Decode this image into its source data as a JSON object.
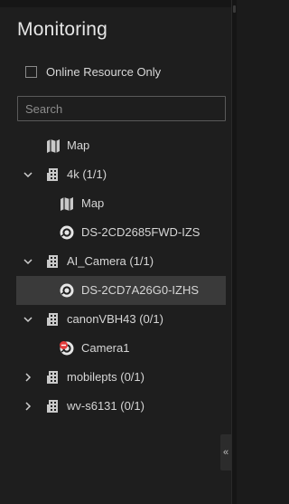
{
  "panel": {
    "title": "Monitoring"
  },
  "filter": {
    "online_only_label": "Online Resource Only",
    "checked": false
  },
  "search": {
    "placeholder": "Search",
    "value": ""
  },
  "tree": [
    {
      "label": "Map",
      "icon": "map-icon",
      "level": 1,
      "expandable": false
    },
    {
      "label": "4k (1/1)",
      "icon": "building-icon",
      "level": 0,
      "expandable": true,
      "expanded": true
    },
    {
      "label": "Map",
      "icon": "map-icon",
      "level": 2,
      "expandable": false
    },
    {
      "label": "DS-2CD2685FWD-IZS",
      "icon": "camera-icon",
      "level": 2,
      "expandable": false
    },
    {
      "label": "AI_Camera (1/1)",
      "icon": "building-icon",
      "level": 0,
      "expandable": true,
      "expanded": true
    },
    {
      "label": "DS-2CD7A26G0-IZHS",
      "icon": "camera-icon",
      "level": 2,
      "expandable": false,
      "selected": true
    },
    {
      "label": "canonVBH43 (0/1)",
      "icon": "building-icon",
      "level": 0,
      "expandable": true,
      "expanded": true
    },
    {
      "label": "Camera1",
      "icon": "camera-offline-icon",
      "level": 2,
      "expandable": false
    },
    {
      "label": "mobilepts (0/1)",
      "icon": "building-icon",
      "level": 0,
      "expandable": true,
      "expanded": false
    },
    {
      "label": "wv-s6131 (0/1)",
      "icon": "building-icon",
      "level": 0,
      "expandable": true,
      "expanded": false
    }
  ],
  "collapse_handle": {
    "icon": "double-chevron-left-icon",
    "glyph": "«"
  }
}
